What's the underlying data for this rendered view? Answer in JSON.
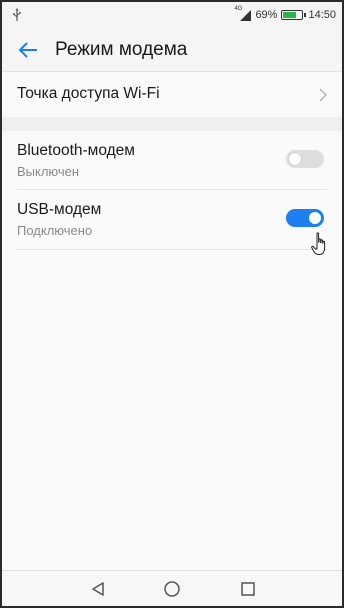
{
  "status_bar": {
    "network_type": "4G",
    "battery_percent": "69%",
    "battery_level": 0.69,
    "time": "14:50",
    "battery_color": "#2db34a"
  },
  "header": {
    "title": "Режим модема",
    "back_icon": "arrow-left-icon",
    "accent_color": "#1e7ff0"
  },
  "items": [
    {
      "title": "Точка доступа Wi-Fi",
      "type": "link",
      "icon": "chevron-right-icon"
    },
    {
      "title": "Bluetooth-модем",
      "status": "Выключен",
      "type": "toggle",
      "checked": false
    },
    {
      "title": "USB-модем",
      "status": "Подключено",
      "type": "toggle",
      "checked": true
    }
  ],
  "nav_bar": {
    "buttons": [
      "back-triangle-icon",
      "home-circle-icon",
      "recents-square-icon"
    ]
  }
}
